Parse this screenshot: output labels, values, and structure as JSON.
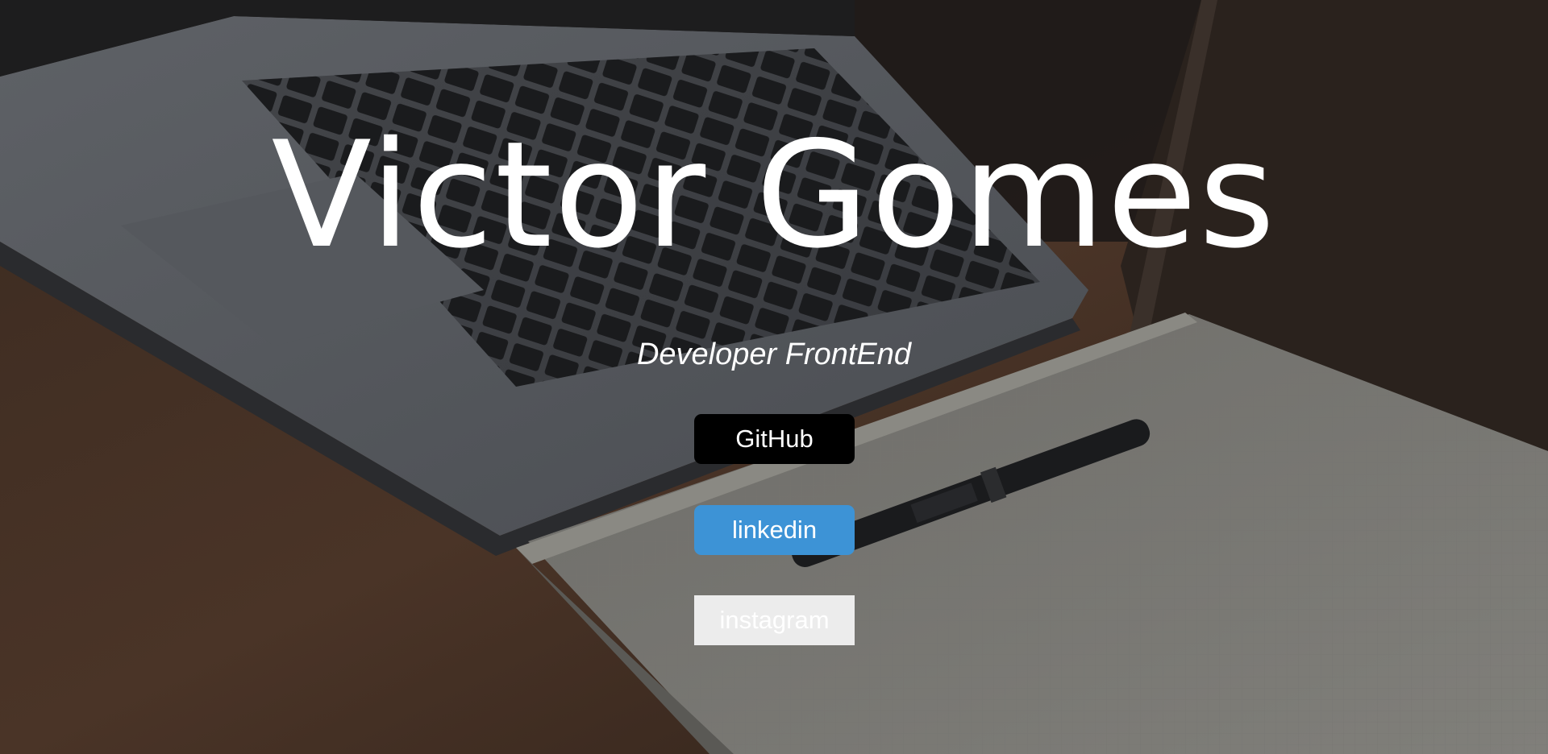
{
  "hero": {
    "name": "Victor Gomes",
    "role": "Developer FrontEnd"
  },
  "links": {
    "github_label": "GitHub",
    "linkedin_label": "linkedin",
    "instagram_label": "instagram"
  },
  "colors": {
    "github_bg": "#000000",
    "linkedin_bg": "#3d93d6",
    "instagram_bg": "#ececec",
    "text": "#ffffff"
  }
}
